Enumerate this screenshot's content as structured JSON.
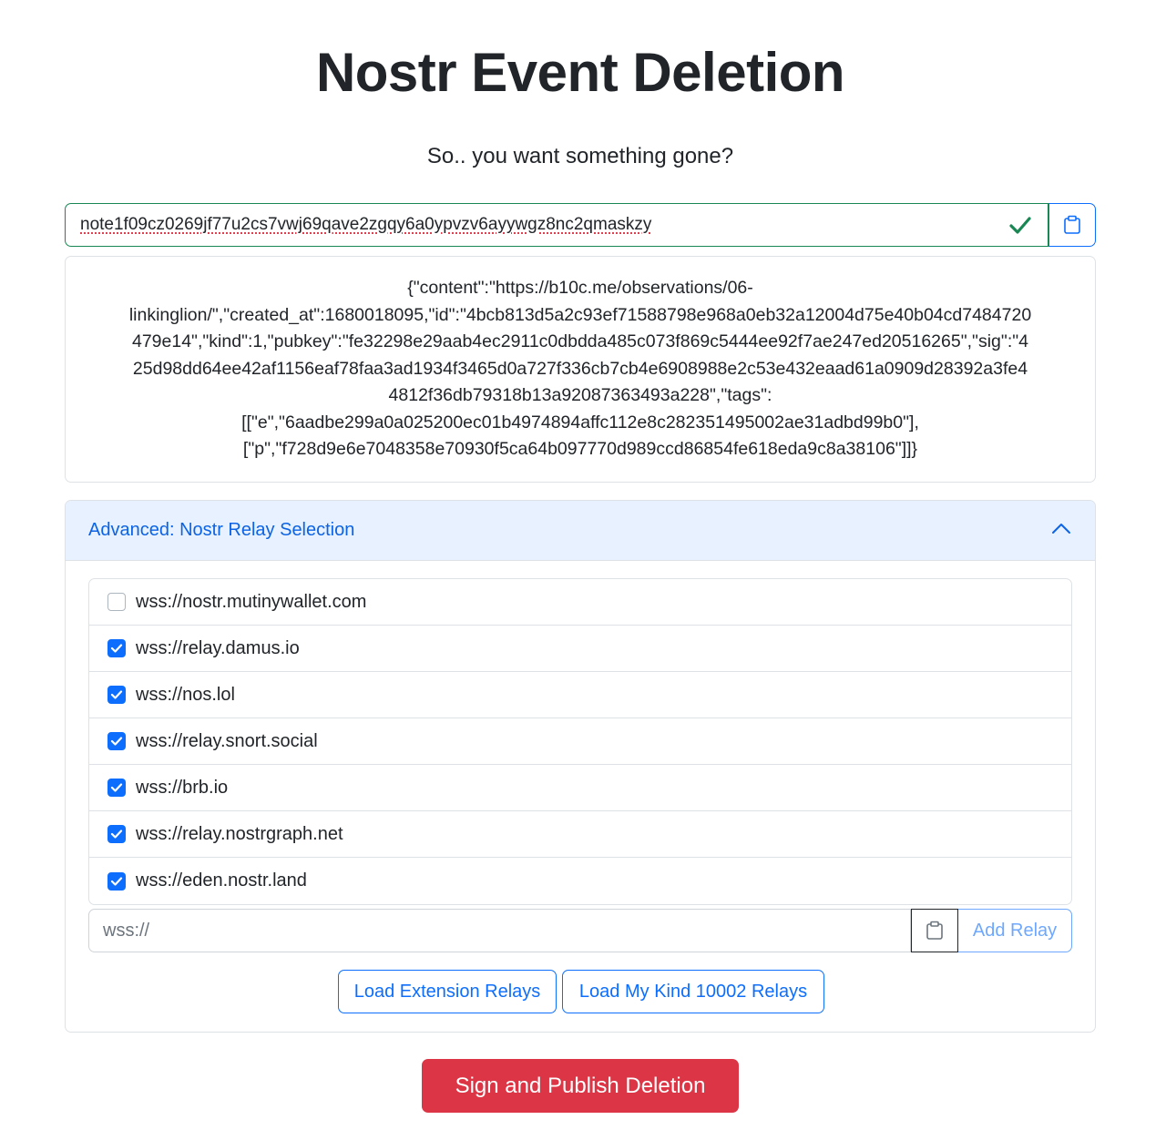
{
  "page": {
    "title": "Nostr Event Deletion",
    "subtitle": "So.. you want something gone?"
  },
  "note_input": {
    "value": "note1f09cz0269jf77u2cs7vwj69qave2zgqy6a0ypvzv6ayywgz8nc2qmaskzy",
    "valid": true,
    "valid_icon": "check-icon",
    "paste_icon": "clipboard-icon"
  },
  "event_json": {
    "lines": [
      "{\"content\":\"https://b10c.me/observations/06-",
      "linkinglion/\",\"created_at\":1680018095,\"id\":\"4bcb813d5a2c93ef71588798e968a0eb32a12004d75e40b04cd7484720",
      "479e14\",\"kind\":1,\"pubkey\":\"fe32298e29aab4ec2911c0dbdda485c073f869c5444ee92f7ae247ed20516265\",\"sig\":\"4",
      "25d98dd64ee42af1156eaf78faa3ad1934f3465d0a727f336cb7cb4e6908988e2c53e432eaad61a0909d28392a3fe4",
      "4812f36db79318b13a92087363493a228\",\"tags\":",
      "[[\"e\",\"6aadbe299a0a025200ec01b4974894affc112e8c282351495002ae31adbd99b0\"],",
      "[\"p\",\"f728d9e6e7048358e70930f5ca64b097770d989ccd86854fe618eda9c8a38106\"]]}"
    ]
  },
  "relays_section": {
    "header": "Advanced: Nostr Relay Selection",
    "expanded": true,
    "relays": [
      {
        "url": "wss://nostr.mutinywallet.com",
        "checked": false
      },
      {
        "url": "wss://relay.damus.io",
        "checked": true
      },
      {
        "url": "wss://nos.lol",
        "checked": true
      },
      {
        "url": "wss://relay.snort.social",
        "checked": true
      },
      {
        "url": "wss://brb.io",
        "checked": true
      },
      {
        "url": "wss://relay.nostrgraph.net",
        "checked": true
      },
      {
        "url": "wss://eden.nostr.land",
        "checked": true
      }
    ],
    "add_relay": {
      "placeholder": "wss://",
      "paste_icon": "clipboard-icon",
      "button_label": "Add Relay"
    },
    "load_extension_label": "Load Extension Relays",
    "load_kind_label": "Load My Kind 10002 Relays"
  },
  "submit": {
    "label": "Sign and Publish Deletion"
  },
  "colors": {
    "primary": "#0d6efd",
    "success": "#198754",
    "danger": "#dc3545",
    "accordion_bg": "#e7f1ff",
    "accordion_text": "#0c63e4"
  }
}
